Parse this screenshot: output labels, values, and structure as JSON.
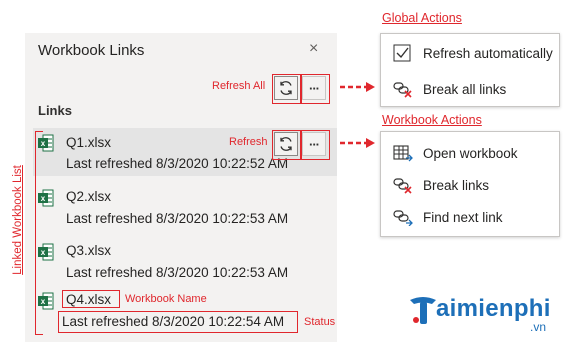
{
  "pane": {
    "title": "Workbook Links",
    "close_glyph": "×",
    "links_header": "Links",
    "refresh_all_icon": "refresh-icon",
    "more_icon": "ellipsis-icon",
    "more_glyph": "···"
  },
  "workbooks": [
    {
      "name": "Q1.xlsx",
      "status": "Last refreshed 8/3/2020 10:22:52 AM",
      "selected": true
    },
    {
      "name": "Q2.xlsx",
      "status": "Last refreshed 8/3/2020 10:22:53 AM",
      "selected": false
    },
    {
      "name": "Q3.xlsx",
      "status": "Last refreshed 8/3/2020 10:22:53 AM",
      "selected": false
    },
    {
      "name": "Q4.xlsx",
      "status": "Last refreshed 8/3/2020 10:22:54 AM",
      "selected": false
    }
  ],
  "annotations": {
    "refresh_all": "Refresh All",
    "refresh": "Refresh",
    "linked_workbook_list": "Linked Workbook List",
    "workbook_name": "Workbook Name",
    "status": "Status",
    "global_actions": "Global Actions",
    "workbook_actions": "Workbook Actions"
  },
  "global_menu": [
    {
      "label": "Refresh automatically",
      "icon": "checkmark-icon"
    },
    {
      "label": "Break all links",
      "icon": "break-link-icon"
    }
  ],
  "workbook_menu": [
    {
      "label": "Open workbook",
      "icon": "open-workbook-icon"
    },
    {
      "label": "Break links",
      "icon": "break-link-icon"
    },
    {
      "label": "Find next link",
      "icon": "find-link-icon"
    }
  ],
  "watermark": {
    "brand": "aimienphi",
    "suffix": ".vn"
  },
  "colors": {
    "annotation_red": "#e0272d",
    "pane_bg": "#f3f2f1",
    "selected_bg": "#e4e4e4",
    "excel_green": "#1e7145",
    "logo_blue": "#1d6fb8"
  }
}
